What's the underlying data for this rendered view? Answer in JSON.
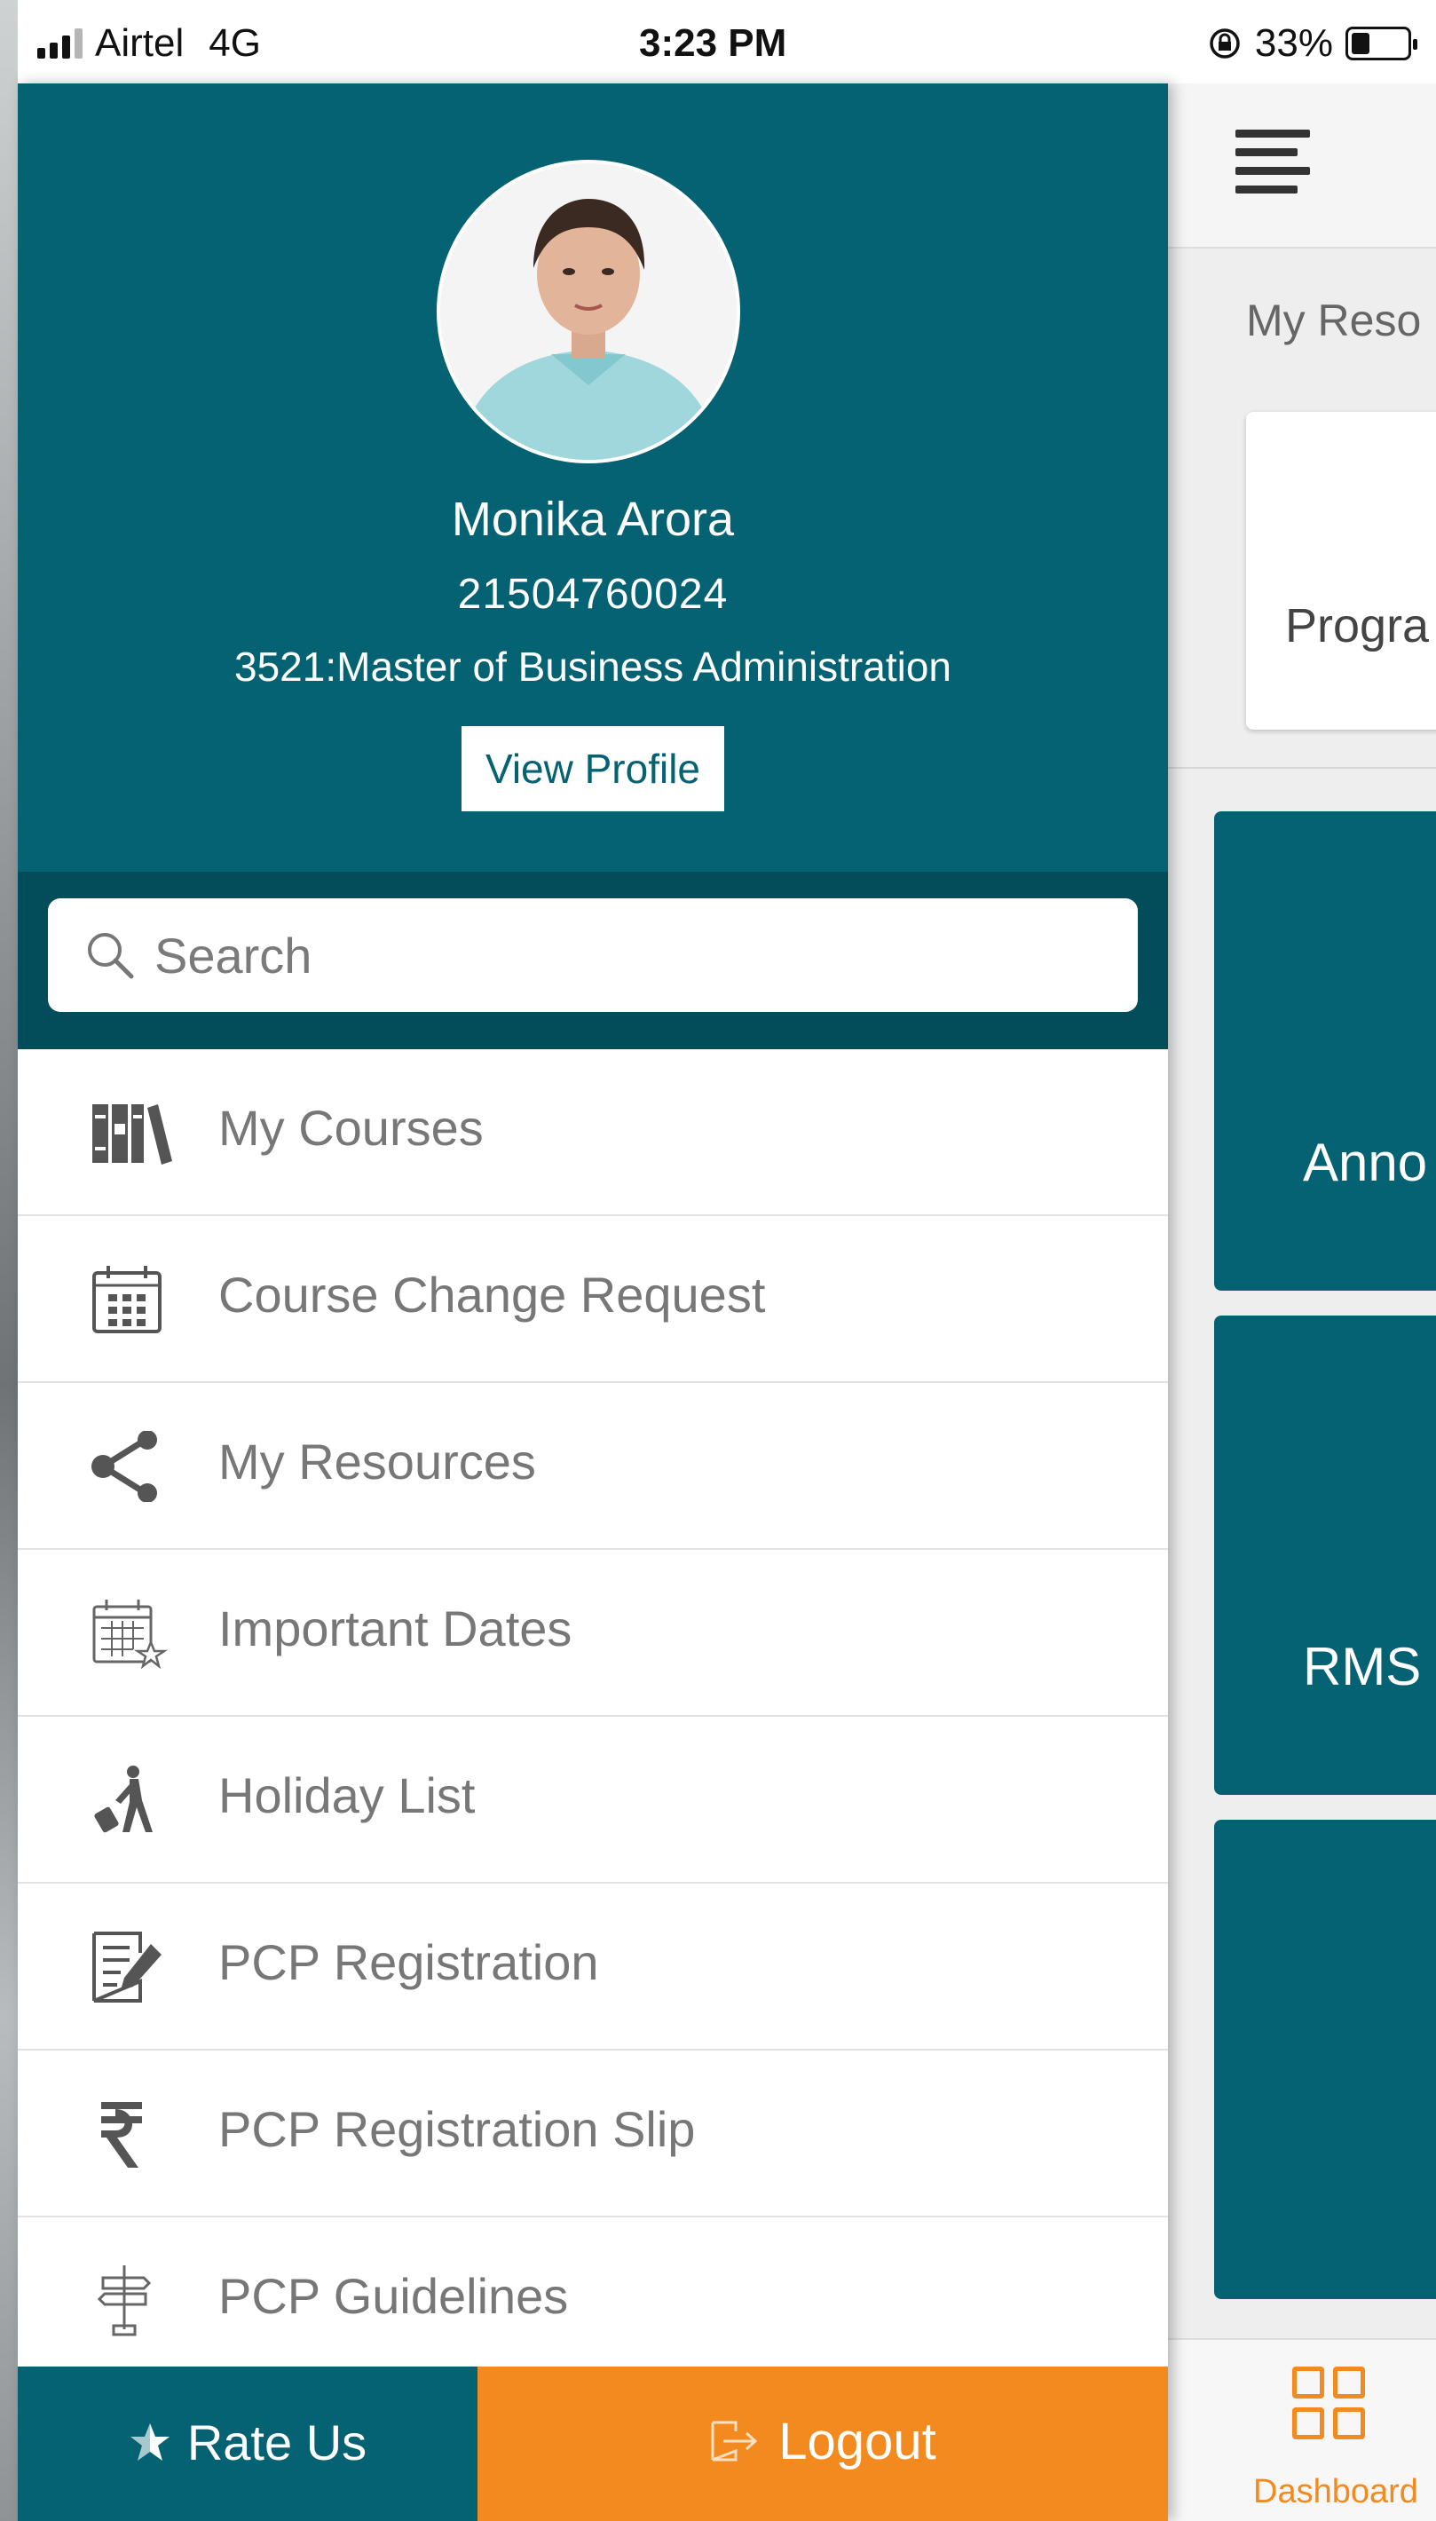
{
  "status_bar": {
    "carrier": "Airtel",
    "network": "4G",
    "time": "3:23 PM",
    "battery_percent": "33%",
    "battery_level": 0.33
  },
  "profile": {
    "name": "Monika Arora",
    "enrollment_id": "21504760024",
    "program": "3521:Master of Business Administration",
    "view_profile_label": "View Profile"
  },
  "search": {
    "placeholder": "Search",
    "value": ""
  },
  "menu": {
    "items": [
      {
        "label": "My Courses",
        "icon": "books-icon"
      },
      {
        "label": "Course Change Request",
        "icon": "calendar-grid-icon"
      },
      {
        "label": "My Resources",
        "icon": "share-icon"
      },
      {
        "label": "Important Dates",
        "icon": "calendar-star-icon"
      },
      {
        "label": "Holiday List",
        "icon": "traveler-icon"
      },
      {
        "label": "PCP Registration",
        "icon": "edit-document-icon"
      },
      {
        "label": "PCP Registration Slip",
        "icon": "rupee-icon"
      },
      {
        "label": "PCP Guidelines",
        "icon": "signpost-icon"
      }
    ]
  },
  "footer": {
    "rate_label": "Rate Us",
    "logout_label": "Logout"
  },
  "main": {
    "section_label": "My Reso",
    "program_card_label": "Progra",
    "tiles": [
      "Anno",
      "RMS",
      ""
    ],
    "bottom_nav_label": "Dashboard"
  },
  "colors": {
    "primary_teal": "#046273",
    "dark_teal": "#034d5b",
    "accent_orange": "#f28a1f",
    "menu_text": "#777777"
  }
}
